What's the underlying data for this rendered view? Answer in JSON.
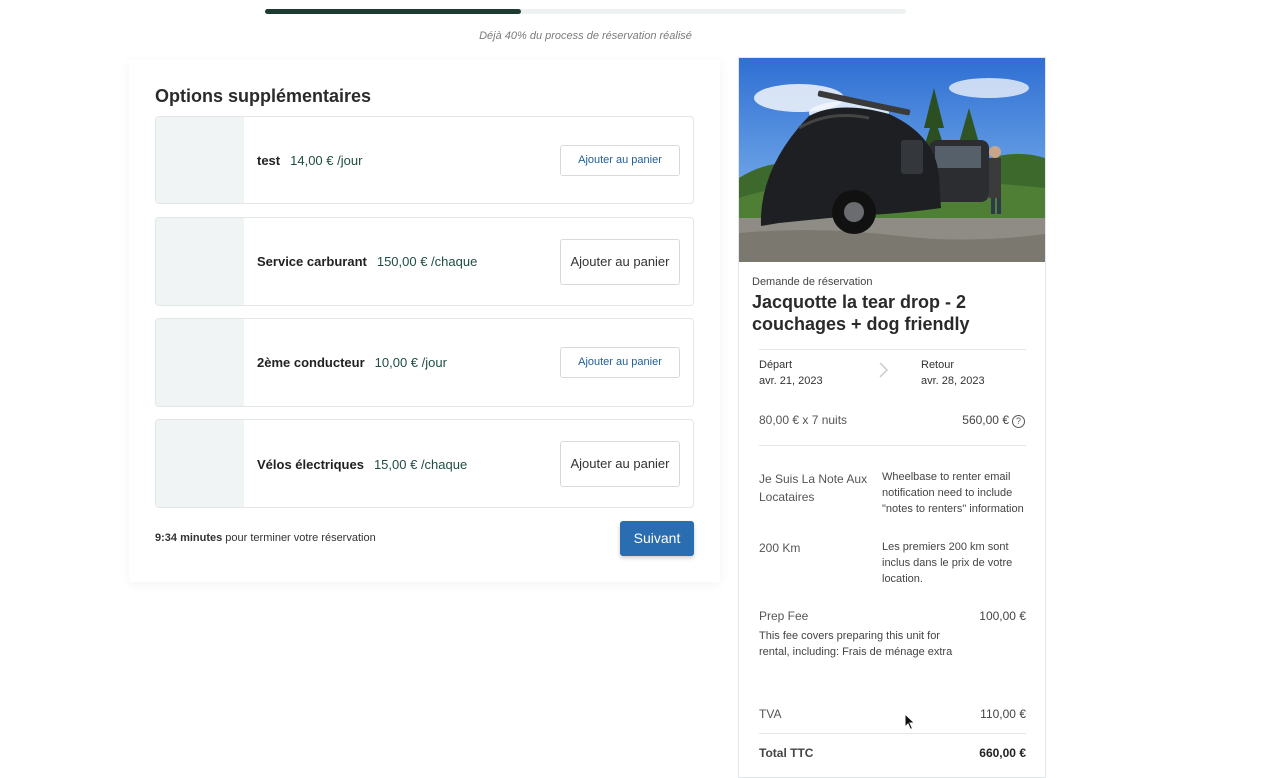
{
  "progress": {
    "percent": 40,
    "label": "Déjà 40% du process de réservation réalisé"
  },
  "options": {
    "title": "Options supplémentaires",
    "items": [
      {
        "name": "test",
        "price": "14,00 € /jour",
        "button": "Ajouter au panier"
      },
      {
        "name": "Service carburant",
        "price": "150,00 € /chaque",
        "button": "Ajouter au panier"
      },
      {
        "name": "2ème conducteur",
        "price": "10,00 € /jour",
        "button": "Ajouter au panier"
      },
      {
        "name": "Vélos électriques",
        "price": "15,00 € /chaque",
        "button": "Ajouter au panier"
      }
    ],
    "timer_strong": "9:34 minutes",
    "timer_rest": " pour terminer votre réservation",
    "next_button": "Suivant"
  },
  "summary": {
    "request_label": "Demande de réservation",
    "title": "Jacquotte la tear drop - 2 couchages + dog friendly",
    "departure_label": "Départ",
    "departure_date": "avr. 21, 2023",
    "return_label": "Retour",
    "return_date": "avr. 28, 2023",
    "nights_text": "80,00 € x 7 nuits",
    "nights_total": "560,00 €",
    "note_label": "Je Suis La Note Aux Locataires",
    "note_text": "Wheelbase to renter email notification need to include \"notes to renters\" information",
    "km_label": "200 Km",
    "km_text": "Les premiers 200 km sont inclus dans le prix de votre location.",
    "prep_label": "Prep Fee",
    "prep_value": "100,00 €",
    "prep_desc": "This fee covers preparing this unit for rental, including: Frais de ménage extra",
    "tva_label": "TVA",
    "tva_value": "110,00 €",
    "total_label": "Total TTC",
    "total_value": "660,00 €"
  },
  "colors": {
    "progress": "#1e3b32",
    "price": "#1f4d44",
    "primary_button": "#2a6db0",
    "link_button_text": "#1f5f99"
  },
  "icons": [
    "chevron-right-icon",
    "help-circle-icon",
    "mouse-cursor-icon"
  ]
}
